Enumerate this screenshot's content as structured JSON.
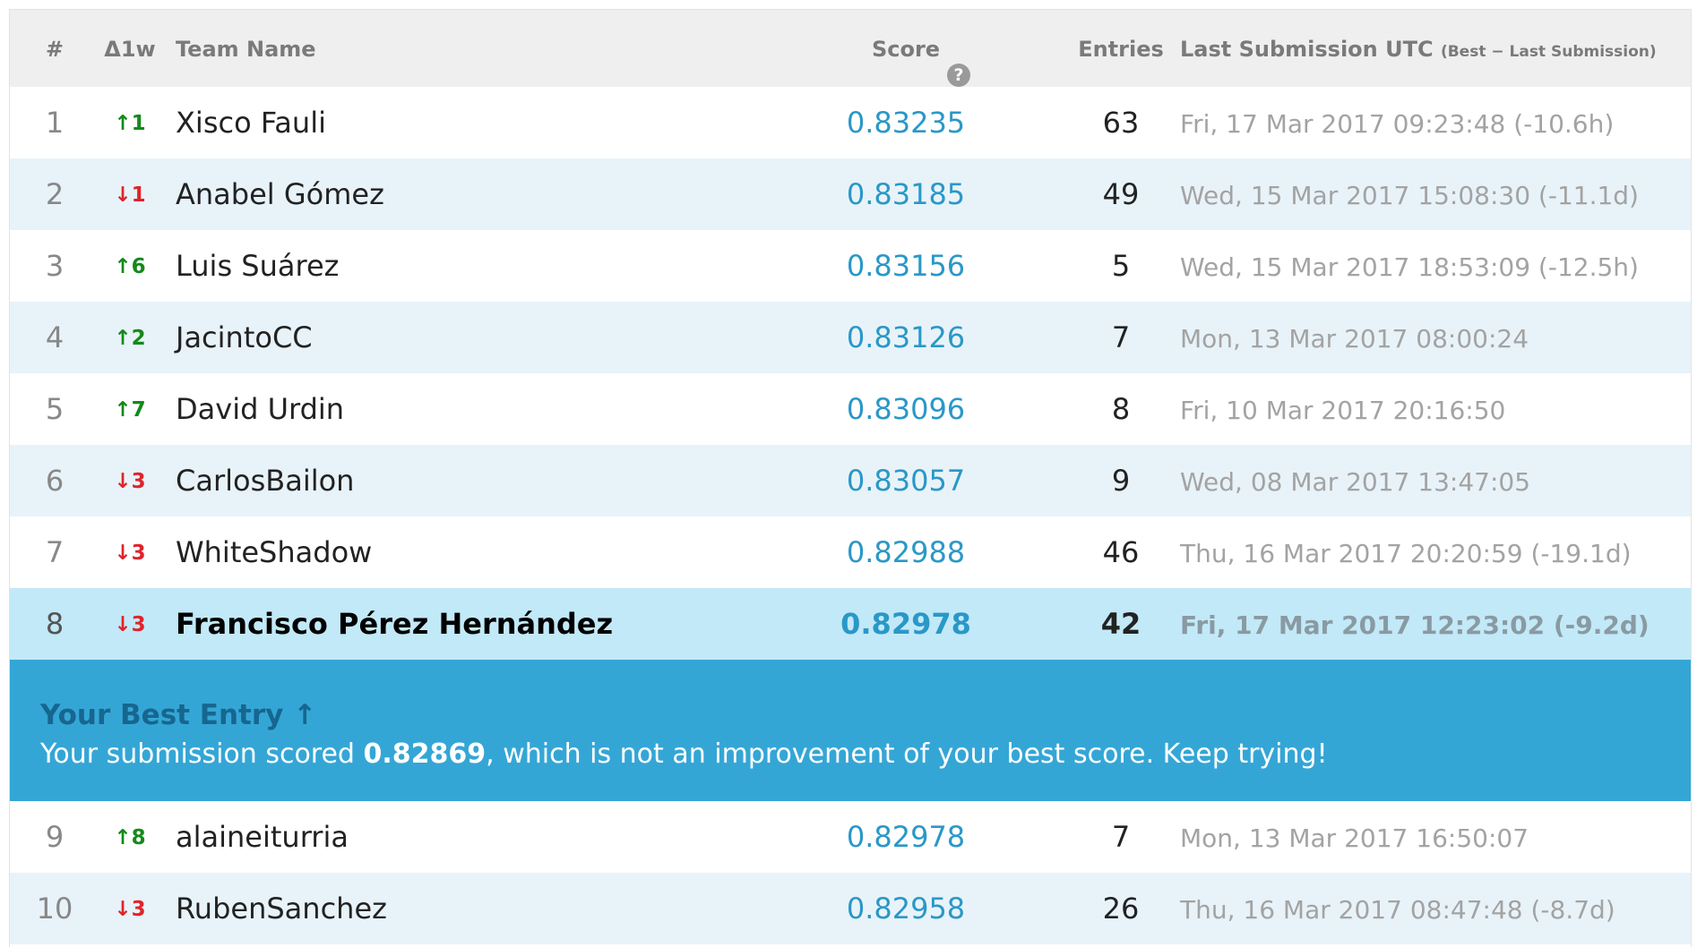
{
  "header": {
    "rank": "#",
    "delta": "Δ1w",
    "team": "Team Name",
    "score": "Score",
    "score_help_icon": "?",
    "entries": "Entries",
    "last": "Last Submission UTC",
    "last_note": "(Best − Last Submission)"
  },
  "rows_top": [
    {
      "rank": "1",
      "delta": "↑1",
      "dir": "up",
      "team": "Xisco Fauli",
      "score": "0.83235",
      "entries": "63",
      "last": "Fri, 17 Mar 2017 09:23:48 (-10.6h)"
    },
    {
      "rank": "2",
      "delta": "↓1",
      "dir": "down",
      "team": "Anabel Gómez",
      "score": "0.83185",
      "entries": "49",
      "last": "Wed, 15 Mar 2017 15:08:30 (-11.1d)"
    },
    {
      "rank": "3",
      "delta": "↑6",
      "dir": "up",
      "team": "Luis Suárez",
      "score": "0.83156",
      "entries": "5",
      "last": "Wed, 15 Mar 2017 18:53:09 (-12.5h)"
    },
    {
      "rank": "4",
      "delta": "↑2",
      "dir": "up",
      "team": "JacintoCC",
      "score": "0.83126",
      "entries": "7",
      "last": "Mon, 13 Mar 2017 08:00:24"
    },
    {
      "rank": "5",
      "delta": "↑7",
      "dir": "up",
      "team": "David Urdin",
      "score": "0.83096",
      "entries": "8",
      "last": "Fri, 10 Mar 2017 20:16:50"
    },
    {
      "rank": "6",
      "delta": "↓3",
      "dir": "down",
      "team": "CarlosBailon",
      "score": "0.83057",
      "entries": "9",
      "last": "Wed, 08 Mar 2017 13:47:05"
    },
    {
      "rank": "7",
      "delta": "↓3",
      "dir": "down",
      "team": "WhiteShadow",
      "score": "0.82988",
      "entries": "46",
      "last": "Thu, 16 Mar 2017 20:20:59 (-19.1d)"
    },
    {
      "rank": "8",
      "delta": "↓3",
      "dir": "down",
      "team": "Francisco Pérez Hernández",
      "score": "0.82978",
      "entries": "42",
      "last": "Fri, 17 Mar 2017 12:23:02 (-9.2d)"
    }
  ],
  "notice": {
    "title": "Your Best Entry ↑",
    "msg_prefix": "Your submission scored ",
    "msg_score": "0.82869",
    "msg_suffix": ", which is not an improvement of your best score. Keep trying!"
  },
  "rows_bottom": [
    {
      "rank": "9",
      "delta": "↑8",
      "dir": "up",
      "team": "alaineiturria",
      "score": "0.82978",
      "entries": "7",
      "last": "Mon, 13 Mar 2017 16:50:07"
    },
    {
      "rank": "10",
      "delta": "↓3",
      "dir": "down",
      "team": "RubenSanchez",
      "score": "0.82958",
      "entries": "26",
      "last": "Thu, 16 Mar 2017 08:47:48 (-8.7d)"
    }
  ],
  "colors": {
    "up": "#138a1a",
    "down": "#e0232a",
    "score": "#2a98c7",
    "notice_bg": "#34a6d6",
    "highlight_row": "#c2e9f8"
  }
}
